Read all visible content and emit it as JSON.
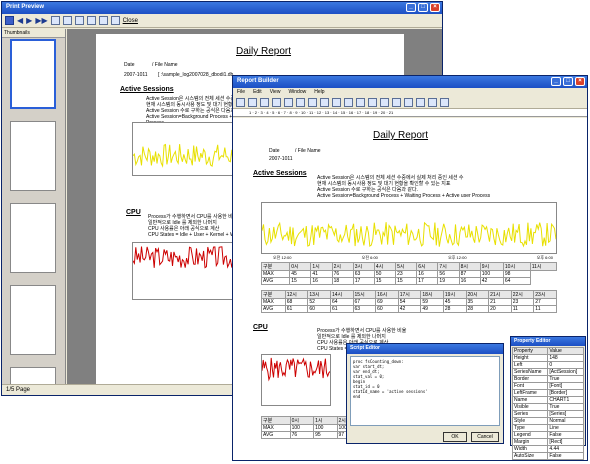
{
  "preview_window": {
    "title": "Print Preview",
    "close_label": "Close",
    "thumbnails_label": "Thumbnails",
    "status": "1/5 Page"
  },
  "report": {
    "title": "Daily Report",
    "date_label": "Date",
    "file_label": "/ File Name",
    "date_value": "2007-1011",
    "file_value": "[ :\\sample_log2007028_dbodi1.db",
    "section_active": "Active Sessions",
    "section_cpu": "CPU",
    "desc_active": [
      "Active Session은 시스템의 전체 세션 수중에서 실제 처리 중인 세션 수",
      "현재 시스템의 동시사용 정도 및 대기 현황을 확인할 수 있는 지표",
      "Active Session 수로 구하는 공식은 다음과 같다.",
      "Active Session=Background Process + Waiting Process + Active user Process"
    ],
    "desc_cpu": [
      "Process가 수행하면서 CPU를 사용한 비율",
      "일반적으로 Idle 를 제외한 나머지",
      "CPU 사용률은 아래 공식으로 계산",
      "CPU States = Idle + User + Kernel + Wait"
    ],
    "times": [
      "오전 12:00",
      "오전 6:00",
      "오후 12:00",
      "오후 6:00"
    ]
  },
  "builder_window": {
    "title": "Report Builder",
    "menu": [
      "File",
      "Edit",
      "View",
      "Window",
      "Help"
    ],
    "ruler": "1 · 2 · 3 · 4 · 5 · 6 · 7 · 8 · 9 · 10 · 11 · 12 · 13 · 14 · 15 · 16 · 17 · 18 · 19 · 20 · 21"
  },
  "active_table": {
    "header": [
      "구분",
      "0시",
      "1시",
      "2시",
      "3시",
      "4시",
      "5시",
      "6시",
      "7시",
      "8시",
      "9시",
      "10시",
      "11시"
    ],
    "rows": [
      {
        "label": "MAX",
        "values": [
          "45",
          "41",
          "76",
          "63",
          "50",
          "23",
          "16",
          "56",
          "87",
          "100",
          "98"
        ]
      },
      {
        "label": "AVG",
        "values": [
          "15",
          "16",
          "18",
          "17",
          "15",
          "15",
          "17",
          "19",
          "16",
          "42",
          "64"
        ]
      }
    ]
  },
  "active_table2": {
    "header": [
      "구분",
      "12시",
      "13시",
      "14시",
      "15시",
      "16시",
      "17시",
      "18시",
      "19시",
      "20시",
      "21시",
      "22시",
      "23시"
    ],
    "rows": [
      {
        "label": "MAX",
        "values": [
          "68",
          "52",
          "64",
          "67",
          "69",
          "54",
          "59",
          "45",
          "35",
          "21",
          "23",
          "27"
        ]
      },
      {
        "label": "AVG",
        "values": [
          "61",
          "60",
          "61",
          "63",
          "60",
          "42",
          "49",
          "28",
          "28",
          "20",
          "11",
          "11"
        ]
      }
    ]
  },
  "cpu_table": {
    "header": [
      "구분",
      "0시",
      "1시",
      "2시"
    ],
    "rows": [
      {
        "label": "MAX",
        "values": [
          "100",
          "100",
          "100"
        ]
      },
      {
        "label": "AVG",
        "values": [
          "76",
          "95",
          "97"
        ]
      }
    ]
  },
  "script_dialog": {
    "title": "Script Editor",
    "code": [
      "proc fsCounting_down:",
      "  var start_dt;",
      "  var end_dt;",
      "  stat_val = 0;",
      "",
      "  begin",
      "    stat_id = 0",
      "    statId_name = 'active sessions'",
      "  end"
    ],
    "ok": "OK",
    "cancel": "Cancel"
  },
  "property_panel": {
    "title": "Property Editor",
    "header": [
      "Property",
      "Value"
    ],
    "rows": [
      [
        "Height",
        "148"
      ],
      [
        "Left",
        "0"
      ],
      [
        "SeriesName",
        "[ActSession]"
      ],
      [
        "Border",
        "True"
      ],
      [
        "Font",
        "[Font]"
      ],
      [
        "LeftFrame",
        "[Border]"
      ],
      [
        "Name",
        "CHART1"
      ],
      [
        "Visible",
        "True"
      ],
      [
        "Series",
        "[Series]"
      ],
      [
        "Style",
        "Normal"
      ],
      [
        "Type",
        "Line"
      ],
      [
        "Legend",
        "False"
      ],
      [
        "Margin",
        "[Rect]"
      ],
      [
        "Width",
        "4.44"
      ],
      [
        "AutoSize",
        "False"
      ]
    ]
  },
  "colors": {
    "title_bar": "#1c4fc4",
    "active_line": "#e8e000",
    "cpu_line": "#cc0000",
    "window_bg": "#ece9d8"
  }
}
